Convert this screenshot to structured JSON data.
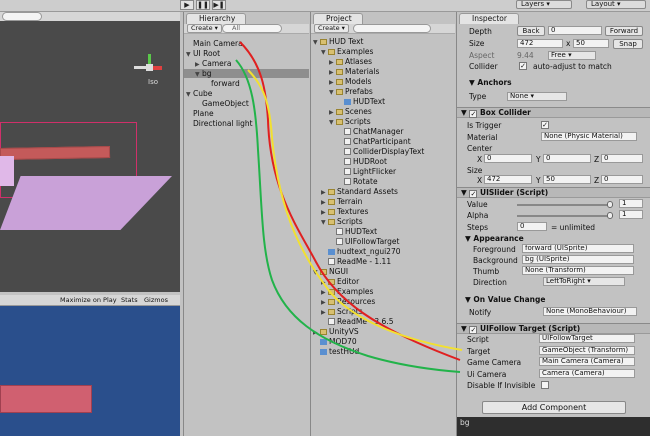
{
  "toolbar": {
    "play_icon": "play-icon",
    "pause_icon": "pause-icon",
    "step_icon": "step-icon",
    "layers": "Layers",
    "layout": "Layout"
  },
  "scene": {
    "persp_label": "Iso"
  },
  "game": {
    "maximize": "Maximize on Play",
    "stats": "Stats",
    "gizmos": "Gizmos"
  },
  "hierarchy": {
    "tab": "Hierarchy",
    "create": "Create",
    "search": "All",
    "items": [
      {
        "label": "Main Camera",
        "indent": 0,
        "arrow": ""
      },
      {
        "label": "UI Root",
        "indent": 0,
        "arrow": "▼"
      },
      {
        "label": "Camera",
        "indent": 1,
        "arrow": "▶"
      },
      {
        "label": "bg",
        "indent": 1,
        "arrow": "▼",
        "selected": true
      },
      {
        "label": "forward",
        "indent": 2,
        "arrow": ""
      },
      {
        "label": "Cube",
        "indent": 0,
        "arrow": "▼"
      },
      {
        "label": "GameObject",
        "indent": 1,
        "arrow": ""
      },
      {
        "label": "Plane",
        "indent": 0,
        "arrow": ""
      },
      {
        "label": "Directional light",
        "indent": 0,
        "arrow": ""
      }
    ]
  },
  "project": {
    "tab": "Project",
    "create": "Create",
    "items": [
      {
        "label": "HUD Text",
        "indent": 0,
        "arrow": "▼",
        "icon": "folder"
      },
      {
        "label": "Examples",
        "indent": 1,
        "arrow": "▼",
        "icon": "folder"
      },
      {
        "label": "Atlases",
        "indent": 2,
        "arrow": "▶",
        "icon": "folder"
      },
      {
        "label": "Materials",
        "indent": 2,
        "arrow": "▶",
        "icon": "folder"
      },
      {
        "label": "Models",
        "indent": 2,
        "arrow": "▶",
        "icon": "folder"
      },
      {
        "label": "Prefabs",
        "indent": 2,
        "arrow": "▼",
        "icon": "folder"
      },
      {
        "label": "HUDText",
        "indent": 3,
        "arrow": "",
        "icon": "prefab"
      },
      {
        "label": "Scenes",
        "indent": 2,
        "arrow": "▶",
        "icon": "folder"
      },
      {
        "label": "Scripts",
        "indent": 2,
        "arrow": "▼",
        "icon": "folder"
      },
      {
        "label": "ChatManager",
        "indent": 3,
        "arrow": "",
        "icon": "script"
      },
      {
        "label": "ChatParticipant",
        "indent": 3,
        "arrow": "",
        "icon": "script"
      },
      {
        "label": "ColliderDisplayText",
        "indent": 3,
        "arrow": "",
        "icon": "script"
      },
      {
        "label": "HUDRoot",
        "indent": 3,
        "arrow": "",
        "icon": "script"
      },
      {
        "label": "LightFlicker",
        "indent": 3,
        "arrow": "",
        "icon": "script"
      },
      {
        "label": "Rotate",
        "indent": 3,
        "arrow": "",
        "icon": "script"
      },
      {
        "label": "Standard Assets",
        "indent": 1,
        "arrow": "▶",
        "icon": "folder"
      },
      {
        "label": "Terrain",
        "indent": 1,
        "arrow": "▶",
        "icon": "folder"
      },
      {
        "label": "Textures",
        "indent": 1,
        "arrow": "▶",
        "icon": "folder"
      },
      {
        "label": "Scripts",
        "indent": 1,
        "arrow": "▼",
        "icon": "folder"
      },
      {
        "label": "HUDText",
        "indent": 2,
        "arrow": "",
        "icon": "script"
      },
      {
        "label": "UIFollowTarget",
        "indent": 2,
        "arrow": "",
        "icon": "script"
      },
      {
        "label": "hudtext_ngui270",
        "indent": 1,
        "arrow": "",
        "icon": "unity"
      },
      {
        "label": "ReadMe - 1.11",
        "indent": 1,
        "arrow": "",
        "icon": "doc"
      },
      {
        "label": "NGUI",
        "indent": 0,
        "arrow": "▼",
        "icon": "folder"
      },
      {
        "label": "Editor",
        "indent": 1,
        "arrow": "▶",
        "icon": "folder"
      },
      {
        "label": "Examples",
        "indent": 1,
        "arrow": "▶",
        "icon": "folder"
      },
      {
        "label": "Resources",
        "indent": 1,
        "arrow": "▶",
        "icon": "folder"
      },
      {
        "label": "Scripts",
        "indent": 1,
        "arrow": "▶",
        "icon": "folder"
      },
      {
        "label": "ReadMe - 3.6.5",
        "indent": 1,
        "arrow": "",
        "icon": "doc"
      },
      {
        "label": "UnityVS",
        "indent": 0,
        "arrow": "▶",
        "icon": "folder"
      },
      {
        "label": "MOD70",
        "indent": 0,
        "arrow": "",
        "icon": "unity"
      },
      {
        "label": "testHUd",
        "indent": 0,
        "arrow": "",
        "icon": "unity"
      }
    ]
  },
  "inspector": {
    "tab": "Inspector",
    "depth_label": "Depth",
    "back": "Back",
    "depth_value": "0",
    "forward": "Forward",
    "size_label": "Size",
    "size_w": "472",
    "size_x": "x",
    "size_h": "50",
    "snap": "Snap",
    "aspect_label": "Aspect",
    "aspect_value": "9.44",
    "aspect_mode": "Free",
    "collider_label": "Collider",
    "collider_value": "auto-adjust to match",
    "anchors": {
      "title": "Anchors",
      "type_label": "Type",
      "type_value": "None"
    },
    "box_collider": {
      "title": "Box Collider",
      "is_trigger": "Is Trigger",
      "material": "Material",
      "material_value": "None (Physic Material)",
      "center": "Center",
      "cx": "0",
      "cy": "0",
      "cz": "0",
      "size": "Size",
      "sx": "472",
      "sy": "50",
      "sz": "0",
      "x": "X",
      "y": "Y",
      "z": "Z"
    },
    "uislider": {
      "title": "UISlider (Script)",
      "value": "Value",
      "value_num": "1",
      "value_pct": 1,
      "alpha": "Alpha",
      "alpha_num": "1",
      "alpha_pct": 1,
      "steps": "Steps",
      "steps_num": "0",
      "steps_note": "= unlimited"
    },
    "appearance": {
      "title": "Appearance",
      "foreground": "Foreground",
      "foreground_value": "forward (UISprite)",
      "background": "Background",
      "background_value": "bg (UISprite)",
      "thumb": "Thumb",
      "thumb_value": "None (Transform)",
      "direction": "Direction",
      "direction_value": "LeftToRight"
    },
    "on_value_change": {
      "title": "On Value Change",
      "notify": "Notify",
      "notify_value": "None (MonoBehaviour)"
    },
    "uifollow": {
      "title": "UIFollow Target (Script)",
      "script": "Script",
      "script_value": "UIFollowTarget",
      "target": "Target",
      "target_value": "GameObject (Transform)",
      "game_camera": "Game Camera",
      "game_camera_value": "Main Camera (Camera)",
      "ui_camera": "Ui Camera",
      "ui_camera_value": "Camera (Camera)",
      "disable": "Disable If Invisible"
    },
    "add_component": "Add Component",
    "preview_label": "bg"
  },
  "colors": {
    "red_stroke": "#e02020",
    "yellow_stroke": "#f2e030",
    "green_stroke": "#22b34a"
  }
}
